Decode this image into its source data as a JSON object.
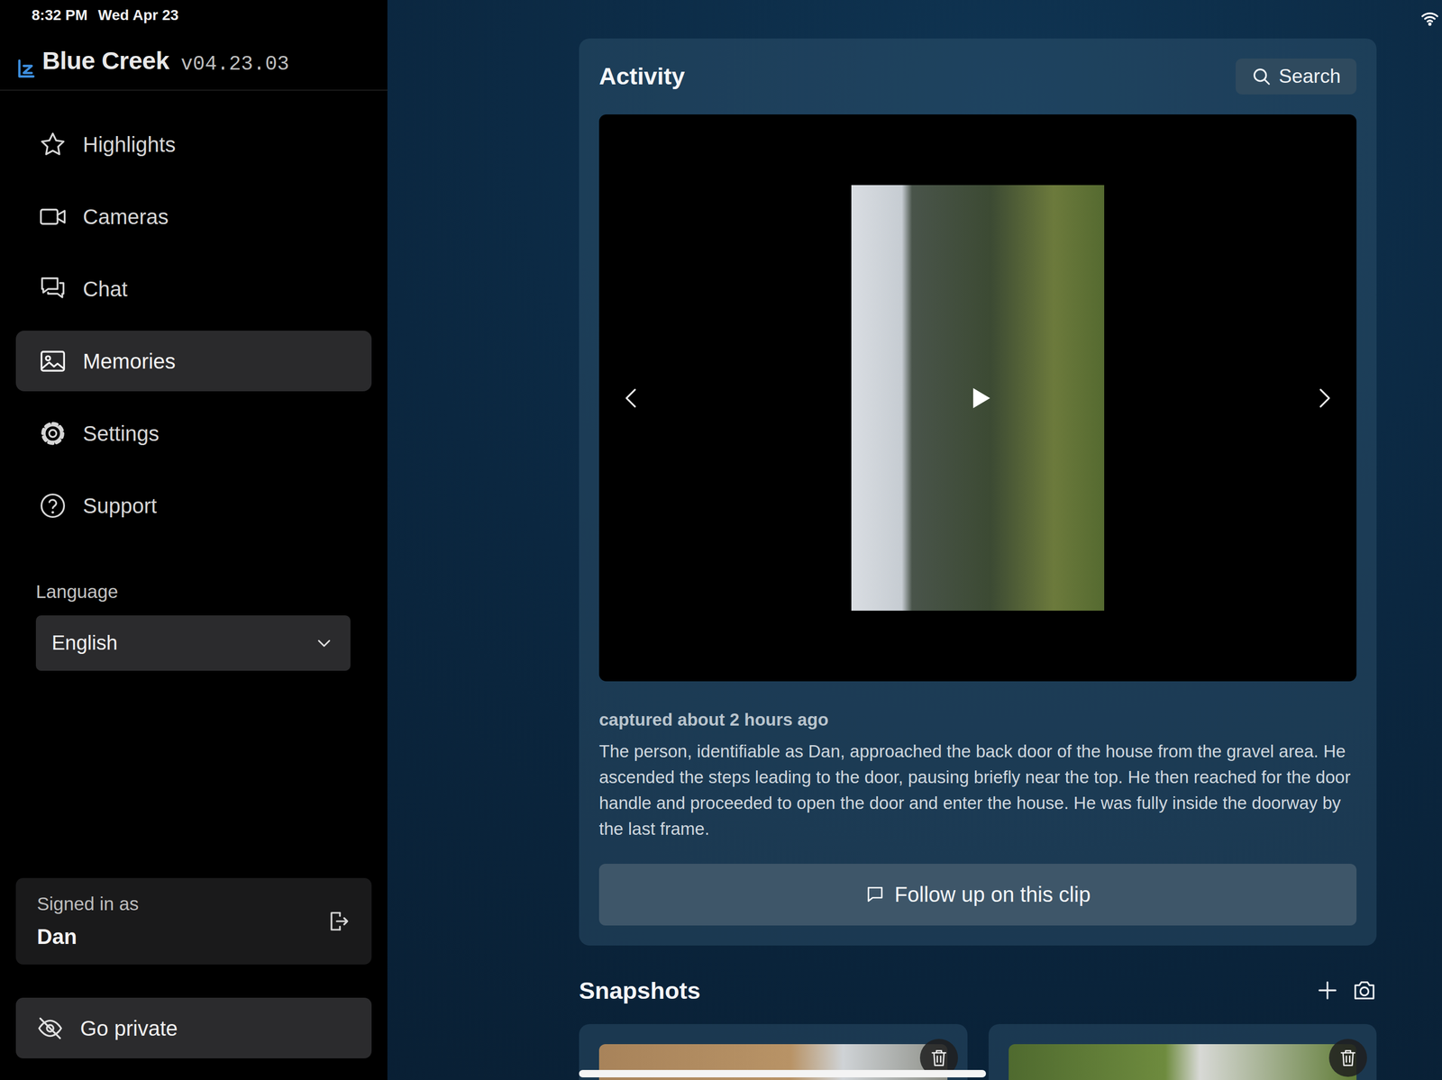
{
  "status_bar": {
    "time": "8:32 PM",
    "date": "Wed Apr 23"
  },
  "app": {
    "name": "Blue Creek",
    "version": "v04.23.03"
  },
  "sidebar": {
    "items": [
      {
        "label": "Highlights",
        "selected": false
      },
      {
        "label": "Cameras",
        "selected": false
      },
      {
        "label": "Chat",
        "selected": false
      },
      {
        "label": "Memories",
        "selected": true
      },
      {
        "label": "Settings",
        "selected": false
      },
      {
        "label": "Support",
        "selected": false
      }
    ]
  },
  "language": {
    "label": "Language",
    "value": "English"
  },
  "account": {
    "label": "Signed in as",
    "user": "Dan"
  },
  "private_button": "Go private",
  "activity": {
    "title": "Activity",
    "search": "Search",
    "captured": "captured about 2 hours ago",
    "description": "The person, identifiable as Dan, approached the back door of the house from the gravel area. He ascended the steps leading to the door, pausing briefly near the top. He then reached for the door handle and proceeded to open the door and enter the house. He was fully inside the doorway by the last frame.",
    "follow_up": "Follow up on this clip"
  },
  "snapshots": {
    "title": "Snapshots",
    "scroll_level": 0.51,
    "items": [
      {
        "kind": "doorway"
      },
      {
        "kind": "yard"
      }
    ]
  }
}
